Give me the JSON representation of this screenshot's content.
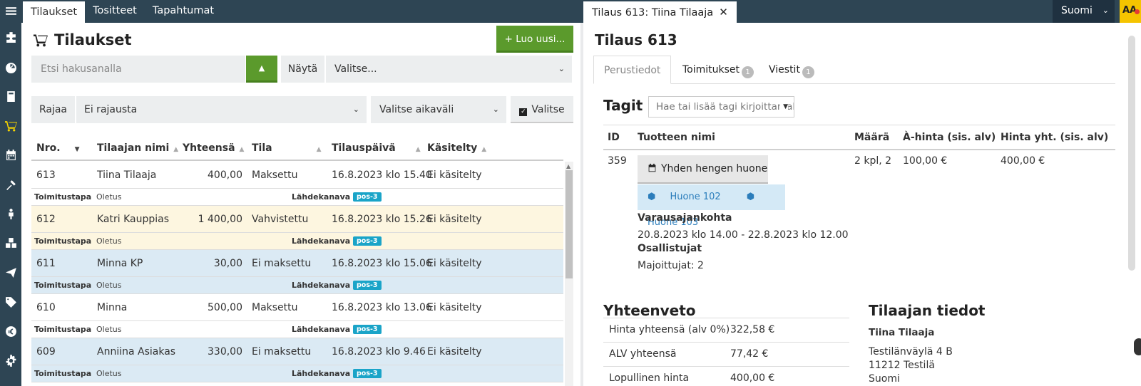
{
  "tabs": [
    {
      "label": "Tilaukset"
    },
    {
      "label": "Tositteet"
    },
    {
      "label": "Tapahtumat"
    }
  ],
  "detail_tab": {
    "label": "Tilaus 613: Tiina Tilaaja",
    "close": "✕"
  },
  "language": {
    "label": "Suomi"
  },
  "font_size_label": "AA",
  "sidebar": {
    "icons": [
      "menu-icon",
      "puzzle-icon",
      "dashboard-icon",
      "book-icon",
      "cart-icon",
      "calendar-icon",
      "tools-icon",
      "person-icon",
      "boxes-icon",
      "send-icon",
      "tag-icon",
      "euro-icon",
      "gear-icon"
    ],
    "active": "cart-icon"
  },
  "orders": {
    "title": "Tilaukset",
    "new_button": "+ Luo uusi...",
    "search_placeholder": "Etsi hakusanalla",
    "show_label": "Näytä",
    "show_value": "Valitse...",
    "filter_label": "Rajaa",
    "filter_value": "Ei rajausta",
    "time_value": "Valitse aikaväli",
    "choose_label": "Valitse",
    "columns": [
      "Nro.",
      "Tilaajan nimi",
      "Yhteensä",
      "Tila",
      "Tilauspäivä",
      "Käsitelty"
    ],
    "sub_labels": {
      "delivery": "Toimitustapa",
      "channel": "Lähdekanava"
    },
    "rows": [
      {
        "nro": "613",
        "name": "Tiina Tilaaja",
        "total": "400,00",
        "state": "Maksettu",
        "date": "16.8.2023 klo 15.40",
        "handled": "Ei käsitelty",
        "delivery": "Oletus",
        "channel": "pos-3",
        "bg": "#ffffff"
      },
      {
        "nro": "612",
        "name": "Katri Kauppias",
        "total": "1 400,00",
        "state": "Vahvistettu",
        "date": "16.8.2023 klo 15.26",
        "handled": "Ei käsitelty",
        "delivery": "Oletus",
        "channel": "pos-3",
        "bg": "#fdf6e0"
      },
      {
        "nro": "611",
        "name": "Minna KP",
        "total": "30,00",
        "state": "Ei maksettu",
        "date": "16.8.2023 klo 15.06",
        "handled": "Ei käsitelty",
        "delivery": "Oletus",
        "channel": "pos-3",
        "bg": "#dbeaf4"
      },
      {
        "nro": "610",
        "name": "Minna",
        "total": "500,00",
        "state": "Maksettu",
        "date": "16.8.2023 klo 13.06",
        "handled": "Ei käsitelty",
        "delivery": "Oletus",
        "channel": "pos-3",
        "bg": "#ffffff"
      },
      {
        "nro": "609",
        "name": "Anniina Asiakas",
        "total": "330,00",
        "state": "Ei maksettu",
        "date": "16.8.2023 klo 9.46",
        "handled": "Ei käsitelty",
        "delivery": "Oletus",
        "channel": "pos-3",
        "bg": "#dbeaf4"
      }
    ]
  },
  "order": {
    "title": "Tilaus 613",
    "tabs": [
      {
        "label": "Perustiedot"
      },
      {
        "label": "Toimitukset",
        "badge": "1"
      },
      {
        "label": "Viestit",
        "badge": "1"
      }
    ],
    "tags_title": "Tagit",
    "tags_placeholder": "Hae tai lisää tagi kirjoittamalla",
    "product_columns": [
      "ID",
      "Tuotteen nimi",
      "Määrä",
      "À-hinta (sis. alv)",
      "Hinta yht. (sis. alv)"
    ],
    "product": {
      "id": "359",
      "name": "Yhden hengen huone",
      "qty": "2 kpl, 2",
      "unit_price": "100,00 €",
      "total": "400,00 €",
      "rooms": [
        "Huone 102",
        "Huone 103"
      ],
      "time_label": "Varausajankohta",
      "time_value": "20.8.2023 klo 14.00 - 22.8.2023 klo 12.00",
      "participants_label": "Osallistujat",
      "participants_value": "Majoittujat: 2"
    },
    "summary": {
      "title": "Yhteenveto",
      "lines": [
        {
          "label": "Hinta yhteensä (alv 0%)",
          "value": "322,58 €"
        },
        {
          "label": "ALV yhteensä",
          "value": "77,42 €"
        },
        {
          "label": "Lopullinen hinta",
          "value": "400,00 €"
        }
      ]
    },
    "customer": {
      "title": "Tilaajan tiedot",
      "name": "Tiina Tilaaja",
      "address": "Testilänväylä 4 B",
      "postal": "11212 Testilä",
      "country": "Suomi"
    }
  }
}
